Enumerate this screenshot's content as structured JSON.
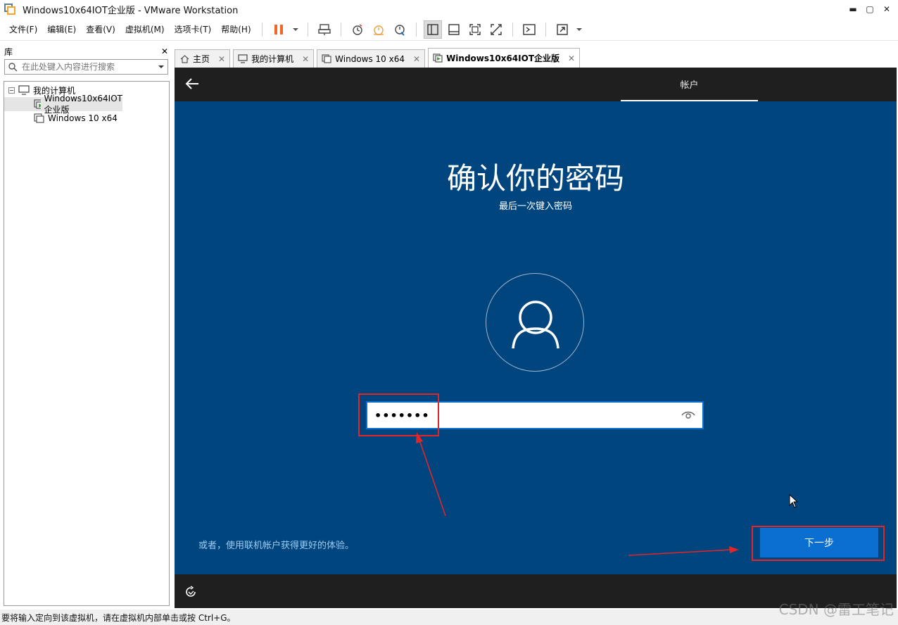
{
  "window": {
    "title": "Windows10x64IOT企业版 - VMware Workstation",
    "minimize_glyph": "▬",
    "maximize_glyph": "▢",
    "close_glyph": "✕"
  },
  "menu": {
    "items": [
      "文件(F)",
      "编辑(E)",
      "查看(V)",
      "虚拟机(M)",
      "选项卡(T)",
      "帮助(H)"
    ]
  },
  "library": {
    "title": "库",
    "close_glyph": "✕",
    "search_placeholder": "在此处键入内容进行搜索",
    "tree": {
      "root": "我的计算机",
      "items": [
        "Windows10x64IOT企业版",
        "Windows 10 x64"
      ]
    }
  },
  "tabs": [
    {
      "label": "主页",
      "icon": "home-icon"
    },
    {
      "label": "我的计算机",
      "icon": "computer-icon"
    },
    {
      "label": "Windows 10 x64",
      "icon": "vm-icon"
    },
    {
      "label": "Windows10x64IOT企业版",
      "icon": "vm-running-icon",
      "active": true
    }
  ],
  "tab_close_glyph": "✕",
  "vm": {
    "section_label": "帐户",
    "title": "确认你的密码",
    "subtitle": "最后一次键入密码",
    "password_mask": "•••••••",
    "online_link": "或者，使用联机帐户获得更好的体验。",
    "next_button": "下一步"
  },
  "status": {
    "text": "要将输入定向到该虚拟机，请在虚拟机内部单击或按 Ctrl+G。"
  },
  "watermark": "CSDN @雷工笔记",
  "colors": {
    "vm_background": "#00457e",
    "vm_bar": "#1f1f1f",
    "accent_button": "#0b6fd1",
    "annotation_red": "#e1262a",
    "pause_orange": "#f26522"
  }
}
